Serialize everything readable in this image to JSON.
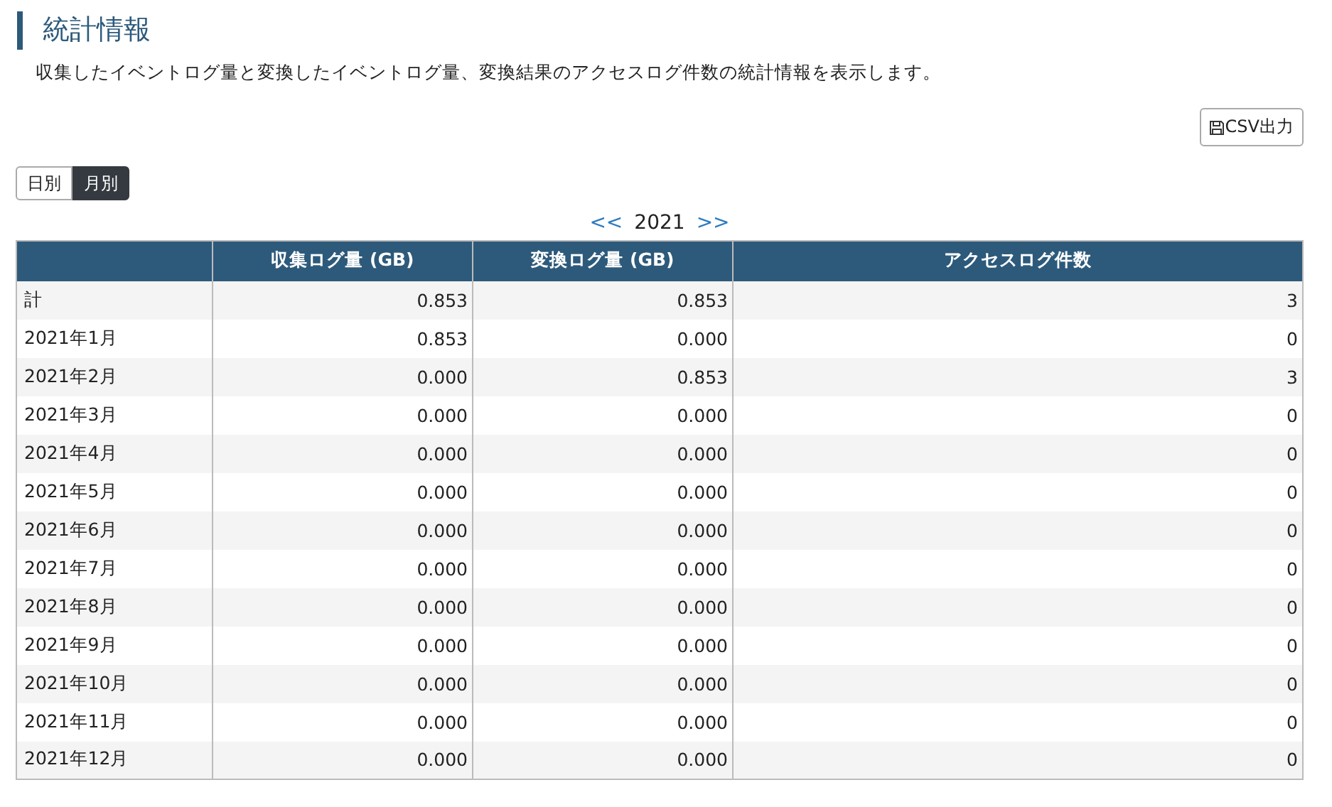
{
  "title": "統計情報",
  "description": "収集したイベントログ量と変換したイベントログ量、変換結果のアクセスログ件数の統計情報を表示します。",
  "csv_button": {
    "label": "CSV出力"
  },
  "view_toggle": [
    {
      "label": "日別",
      "selected": false
    },
    {
      "label": "月別",
      "selected": true
    }
  ],
  "year_nav": {
    "prev": "<<",
    "year": "2021",
    "next": ">>"
  },
  "table": {
    "columns": [
      "",
      "収集ログ量 (GB)",
      "変換ログ量 (GB)",
      "アクセスログ件数"
    ],
    "rows": [
      [
        "計",
        "0.853",
        "0.853",
        "3"
      ],
      [
        "2021年1月",
        "0.853",
        "0.000",
        "0"
      ],
      [
        "2021年2月",
        "0.000",
        "0.853",
        "3"
      ],
      [
        "2021年3月",
        "0.000",
        "0.000",
        "0"
      ],
      [
        "2021年4月",
        "0.000",
        "0.000",
        "0"
      ],
      [
        "2021年5月",
        "0.000",
        "0.000",
        "0"
      ],
      [
        "2021年6月",
        "0.000",
        "0.000",
        "0"
      ],
      [
        "2021年7月",
        "0.000",
        "0.000",
        "0"
      ],
      [
        "2021年8月",
        "0.000",
        "0.000",
        "0"
      ],
      [
        "2021年9月",
        "0.000",
        "0.000",
        "0"
      ],
      [
        "2021年10月",
        "0.000",
        "0.000",
        "0"
      ],
      [
        "2021年11月",
        "0.000",
        "0.000",
        "0"
      ],
      [
        "2021年12月",
        "0.000",
        "0.000",
        "0"
      ]
    ]
  }
}
